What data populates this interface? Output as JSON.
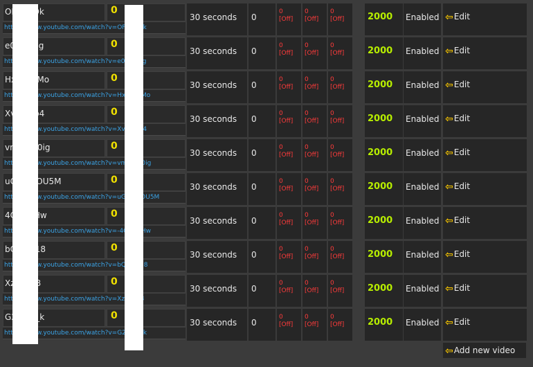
{
  "videos": [
    {
      "id": "OF···GJDk",
      "count": "0",
      "url": "https://www.youtube.com/watch?v=OF···GJDk"
    },
    {
      "id": "e0···oTpg",
      "count": "0",
      "url": "https://www.youtube.com/watch?v=e0···oTpg"
    },
    {
      "id": "Hx···9J1Mo",
      "count": "0",
      "url": "https://www.youtube.com/watch?v=Hx···9J1Mo"
    },
    {
      "id": "Xv···n9p4",
      "count": "0",
      "url": "https://www.youtube.com/watch?v=Xv···n9p4"
    },
    {
      "id": "vm···nH0ig",
      "count": "0",
      "url": "https://www.youtube.com/watch?v=vm···nH0ig"
    },
    {
      "id": "uG···vwOU5M",
      "count": "0",
      "url": "https://www.youtube.com/watch?v=uG···vwOU5M"
    },
    {
      "id": "4C···xTHw",
      "count": "0",
      "url": "https://www.youtube.com/watch?v=-4C···xTHw"
    },
    {
      "id": "bQ···5418",
      "count": "0",
      "url": "https://www.youtube.com/watch?v=bQ···5418"
    },
    {
      "id": "Xz···T0J8",
      "count": "0",
      "url": "https://www.youtube.com/watch?v=Xz···T0J8"
    },
    {
      "id": "G2···SB_k",
      "count": "0",
      "url": "https://www.youtube.com/watch?v=G2···SB_k"
    }
  ],
  "row_common": {
    "duration": "30 seconds",
    "zero": "0",
    "off_value": "0",
    "off_label": "[Off]",
    "value": "2000",
    "status": "Enabled",
    "edit_label": "Edit"
  },
  "add_video_label": "Add new video",
  "colors": {
    "accent_yellow": "#f0e000",
    "value_green": "#b7ee00",
    "off_red": "#ff3b3b",
    "link_blue": "#3ba3e6"
  },
  "icons": {
    "edit": "arrow-left-icon",
    "add": "arrow-left-icon"
  }
}
